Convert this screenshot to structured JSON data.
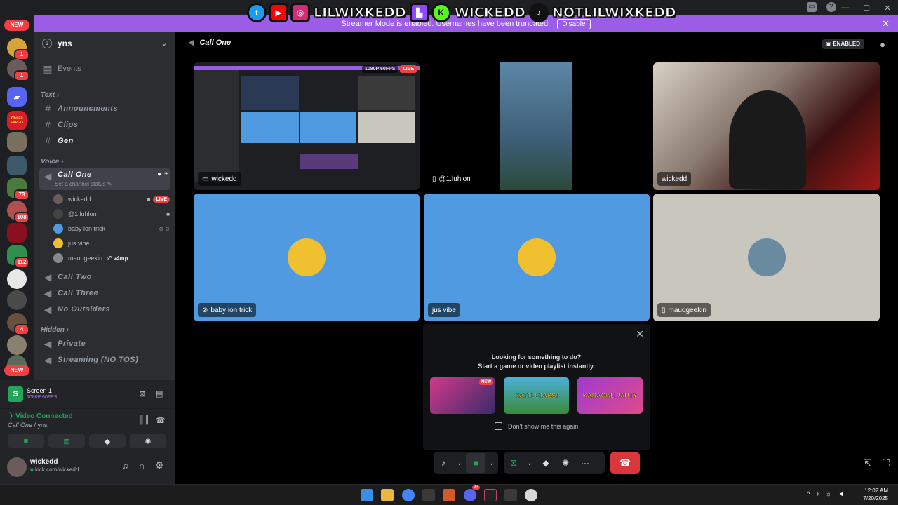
{
  "overlay": {
    "handles": [
      "LILWIXKEDD",
      "WICKEDD",
      "NOTLILWIXKEDD"
    ]
  },
  "banner": {
    "text": "Streamer Mode is enabled. Usernames have been truncated.",
    "disable_label": "Disable"
  },
  "rail": {
    "new_top": "NEW",
    "new_bottom": "NEW",
    "badges": [
      "1",
      "1",
      "73",
      "108",
      "112",
      "4"
    ],
    "wells_label": "WELLS FARGO"
  },
  "server": {
    "name": "yns",
    "unread": "0",
    "events_label": "Events"
  },
  "categories": {
    "text": "Text",
    "voice": "Voice",
    "hidden": "Hidden"
  },
  "text_channels": [
    "Announcments",
    "Clips",
    "Gen"
  ],
  "voice": {
    "active_channel": "Call One",
    "status_placeholder": "Set a channel status",
    "participants": [
      {
        "name": "wickedd",
        "live": "LIVE"
      },
      {
        "name": "@1.luhlon"
      },
      {
        "name": "baby ion trick"
      },
      {
        "name": "jus vibe"
      },
      {
        "name": "maudgeekin",
        "tag": "v4mp"
      }
    ],
    "other_channels": [
      "Call Two",
      "Call Three",
      "No Outsiders"
    ]
  },
  "hidden_channels": [
    "Private",
    "Streaming (NO TOS)"
  ],
  "screen_panel": {
    "title": "Screen 1",
    "quality": "1080P 60FPS"
  },
  "rtc": {
    "status": "Video Connected",
    "channel": "Call One",
    "server": "yns"
  },
  "user_panel": {
    "username": "wickedd",
    "status": "kick.com/wickedd"
  },
  "call": {
    "title": "Call One",
    "enabled_label": "ENABLED",
    "stream_res": "1080P 60FPS",
    "stream_live": "LIVE",
    "tiles": [
      {
        "name": "wickedd"
      },
      {
        "name": "@1.luhlon"
      },
      {
        "name": "wickedd"
      },
      {
        "name": "baby ion trick"
      },
      {
        "name": "jus vibe"
      },
      {
        "name": "maudgeekin"
      }
    ]
  },
  "activity_popup": {
    "line1": "Looking for something to do?",
    "line2": "Start a game or video playlist instantly.",
    "games": [
      "",
      "BATTLETABS!",
      "KARAOKE PARTY"
    ],
    "new_badge": "NEW",
    "dont_show": "Don't show me this again."
  },
  "taskbar": {
    "time": "12:02 AM",
    "date": "7/20/2025",
    "discord_badge": "9+"
  },
  "colors": {
    "accent": "#5865f2",
    "banner": "#9b5de5",
    "danger": "#da373c",
    "connected": "#23a55a",
    "tile_blue": "#4f9ae0"
  }
}
